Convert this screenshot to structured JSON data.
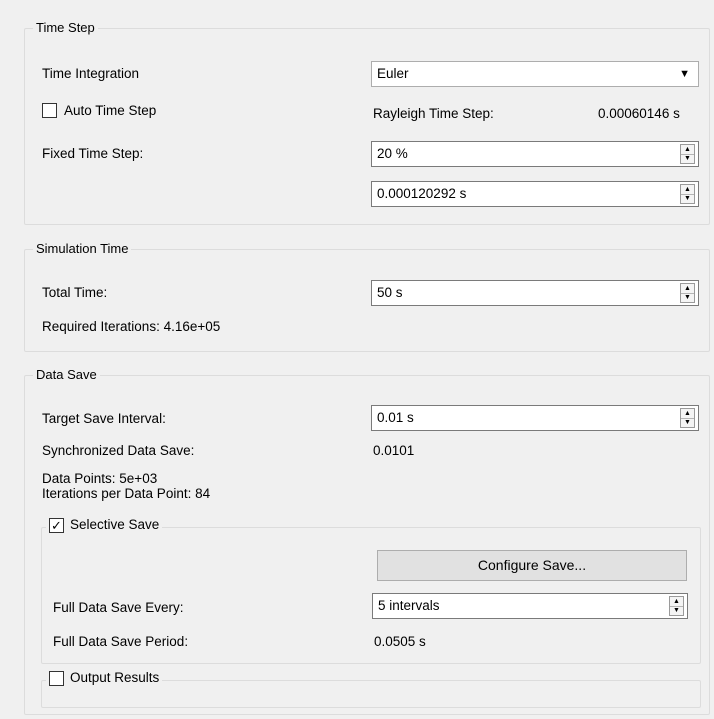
{
  "time_step": {
    "title": "Time Step",
    "integration_label": "Time Integration",
    "integration_value": "Euler",
    "auto_label": "Auto Time Step",
    "auto_checked": false,
    "rayleigh_label": "Rayleigh Time Step:",
    "rayleigh_value": "0.00060146 s",
    "fixed_label": "Fixed Time Step:",
    "fixed_percent": "20 %",
    "fixed_seconds": "0.000120292 s"
  },
  "simulation_time": {
    "title": "Simulation Time",
    "total_label": "Total Time:",
    "total_value": "50 s",
    "required_iterations": "Required Iterations: 4.16e+05"
  },
  "data_save": {
    "title": "Data Save",
    "target_label": "Target Save Interval:",
    "target_value": "0.01 s",
    "sync_label": "Synchronized Data Save:",
    "sync_value": "0.0101",
    "data_points": "Data Points: 5e+03",
    "iterations_per_point": "Iterations per Data Point: 84",
    "selective": {
      "title": "Selective Save",
      "checked": true,
      "configure_label": "Configure Save...",
      "full_every_label": "Full Data Save Every:",
      "full_every_value": "5 intervals",
      "full_period_label": "Full Data Save Period:",
      "full_period_value": "0.0505 s"
    },
    "output": {
      "title": "Output Results",
      "checked": false
    }
  },
  "glyphs": {
    "dropdown": "▼",
    "spin_up": "▲",
    "spin_down": "▼",
    "check": "✓"
  }
}
